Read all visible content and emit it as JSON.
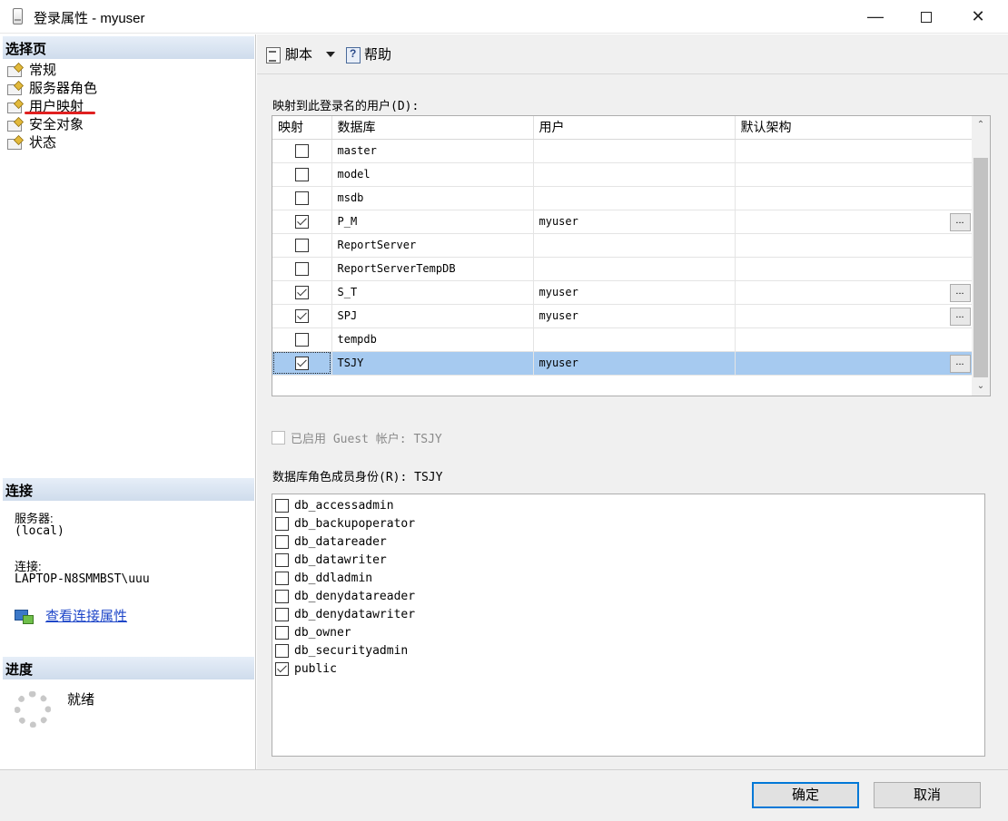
{
  "window": {
    "title": "登录属性 - myuser",
    "min_label": "—",
    "close_label": "✕"
  },
  "left": {
    "select_page_header": "选择页",
    "pages": [
      "常规",
      "服务器角色",
      "用户映射",
      "安全对象",
      "状态"
    ],
    "connection_header": "连接",
    "server_label": "服务器:",
    "server_value": "(local)",
    "connection_label": "连接:",
    "connection_value": "LAPTOP-N8SMMBST\\uuu",
    "view_link": "查看连接属性",
    "progress_header": "进度",
    "progress_status": "就绪"
  },
  "toolbar": {
    "script_label": "脚本",
    "help_label": "帮助"
  },
  "mapping": {
    "label": "映射到此登录名的用户(D):",
    "columns": [
      "映射",
      "数据库",
      "用户",
      "默认架构"
    ],
    "ellipsis": "...",
    "rows": [
      {
        "mapped": false,
        "database": "master",
        "user": ""
      },
      {
        "mapped": false,
        "database": "model",
        "user": ""
      },
      {
        "mapped": false,
        "database": "msdb",
        "user": ""
      },
      {
        "mapped": true,
        "database": "P_M",
        "user": "myuser"
      },
      {
        "mapped": false,
        "database": "ReportServer",
        "user": ""
      },
      {
        "mapped": false,
        "database": "ReportServerTempDB",
        "user": ""
      },
      {
        "mapped": true,
        "database": "S_T",
        "user": "myuser"
      },
      {
        "mapped": true,
        "database": "SPJ",
        "user": "myuser"
      },
      {
        "mapped": false,
        "database": "tempdb",
        "user": ""
      },
      {
        "mapped": true,
        "database": "TSJY",
        "user": "myuser",
        "selected": true
      }
    ],
    "scroll_up": "⌃",
    "scroll_down": "⌄"
  },
  "guest": {
    "label": "已启用 Guest 帐户: TSJY",
    "checked": false
  },
  "roles": {
    "label": "数据库角色成员身份(R): TSJY",
    "items": [
      {
        "name": "db_accessadmin",
        "checked": false
      },
      {
        "name": "db_backupoperator",
        "checked": false
      },
      {
        "name": "db_datareader",
        "checked": false
      },
      {
        "name": "db_datawriter",
        "checked": false
      },
      {
        "name": "db_ddladmin",
        "checked": false
      },
      {
        "name": "db_denydatareader",
        "checked": false
      },
      {
        "name": "db_denydatawriter",
        "checked": false
      },
      {
        "name": "db_owner",
        "checked": false
      },
      {
        "name": "db_securityadmin",
        "checked": false
      },
      {
        "name": "public",
        "checked": true
      }
    ]
  },
  "buttons": {
    "ok": "确定",
    "cancel": "取消"
  },
  "colors": {
    "selection": "#a6caf0",
    "accent": "#0078d7",
    "link": "#1e46c8",
    "annotation": "#e02020"
  }
}
